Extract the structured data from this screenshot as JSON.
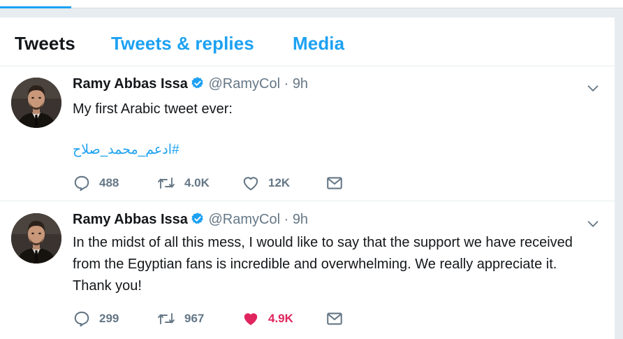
{
  "tabs": {
    "tweets": "Tweets",
    "replies": "Tweets & replies",
    "media": "Media"
  },
  "colors": {
    "accent": "#1da1f2",
    "like_active": "#e0245e",
    "muted": "#657786"
  },
  "tweets": [
    {
      "name": "Ramy Abbas Issa",
      "handle": "@RamyCol",
      "dot": "·",
      "time": "9h",
      "text": "My first Arabic tweet ever:",
      "hashtag": "#ادعم_محمد_صلاح",
      "replies": "488",
      "retweets": "4.0K",
      "likes": "12K",
      "liked": false
    },
    {
      "name": "Ramy Abbas Issa",
      "handle": "@RamyCol",
      "dot": "·",
      "time": "9h",
      "text_lines": [
        "In the midst of all this mess, I would like to say that the support we have received",
        "from the Egyptian fans is incredible and overwhelming. We really appreciate it.",
        "Thank you!"
      ],
      "replies": "299",
      "retweets": "967",
      "likes": "4.9K",
      "liked": true
    }
  ],
  "icons": {
    "verified": "verified-badge-icon",
    "caret": "chevron-down-icon",
    "reply": "reply-bubble-icon",
    "retweet": "retweet-icon",
    "like": "heart-icon",
    "dm": "envelope-icon"
  }
}
